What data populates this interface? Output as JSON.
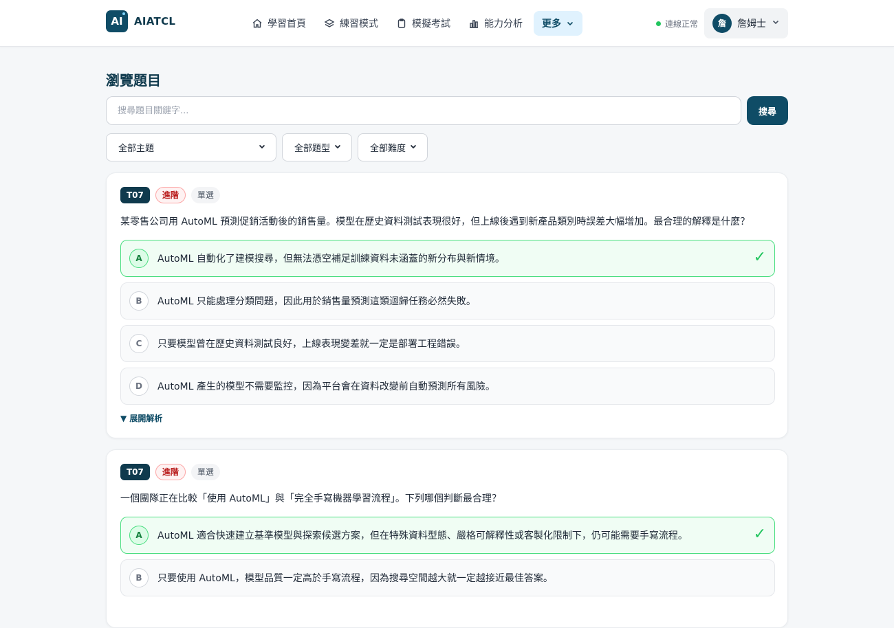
{
  "header": {
    "logo_text": "AI",
    "brand": "AIATCL",
    "nav": [
      {
        "label": "學習首頁",
        "icon": "home-icon"
      },
      {
        "label": "練習模式",
        "icon": "layers-icon"
      },
      {
        "label": "模擬考試",
        "icon": "clipboard-icon"
      },
      {
        "label": "能力分析",
        "icon": "bar-chart-icon"
      }
    ],
    "more_label": "更多",
    "status_text": "連線正常",
    "status_color": "#22c55e",
    "user_initial": "詹",
    "user_name": "詹姆士"
  },
  "page": {
    "title": "瀏覽題目",
    "search_placeholder": "搜尋題目關鍵字...",
    "search_button": "搜尋",
    "filters": {
      "topic": "全部主題",
      "type": "全部題型",
      "difficulty": "全部難度"
    }
  },
  "questions": [
    {
      "topic": "T07",
      "level": "進階",
      "kind": "單選",
      "text": "某零售公司用 AutoML 預測促銷活動後的銷售量。模型在歷史資料測試表現很好，但上線後遇到新產品類別時誤差大幅增加。最合理的解釋是什麼？",
      "options": [
        {
          "letter": "A",
          "text": "AutoML 自動化了建模搜尋，但無法憑空補足訓練資料未涵蓋的新分布與新情境。",
          "correct": true
        },
        {
          "letter": "B",
          "text": "AutoML 只能處理分類問題，因此用於銷售量預測這類迴歸任務必然失敗。",
          "correct": false
        },
        {
          "letter": "C",
          "text": "只要模型曾在歷史資料測試良好，上線表現變差就一定是部署工程錯誤。",
          "correct": false
        },
        {
          "letter": "D",
          "text": "AutoML 產生的模型不需要監控，因為平台會在資料改變前自動預測所有風險。",
          "correct": false
        }
      ],
      "expand_label": "▼ 展開解析"
    },
    {
      "topic": "T07",
      "level": "進階",
      "kind": "單選",
      "text": "一個團隊正在比較「使用 AutoML」與「完全手寫機器學習流程」。下列哪個判斷最合理？",
      "options": [
        {
          "letter": "A",
          "text": "AutoML 適合快速建立基準模型與探索候選方案，但在特殊資料型態、嚴格可解釋性或客製化限制下，仍可能需要手寫流程。",
          "correct": true
        },
        {
          "letter": "B",
          "text": "只要使用 AutoML，模型品質一定高於手寫流程，因為搜尋空間越大就一定越接近最佳答案。",
          "correct": false
        }
      ]
    }
  ],
  "check_glyph": "✓",
  "accent_color": "#0f4c66",
  "correct_color": "#4ade80"
}
